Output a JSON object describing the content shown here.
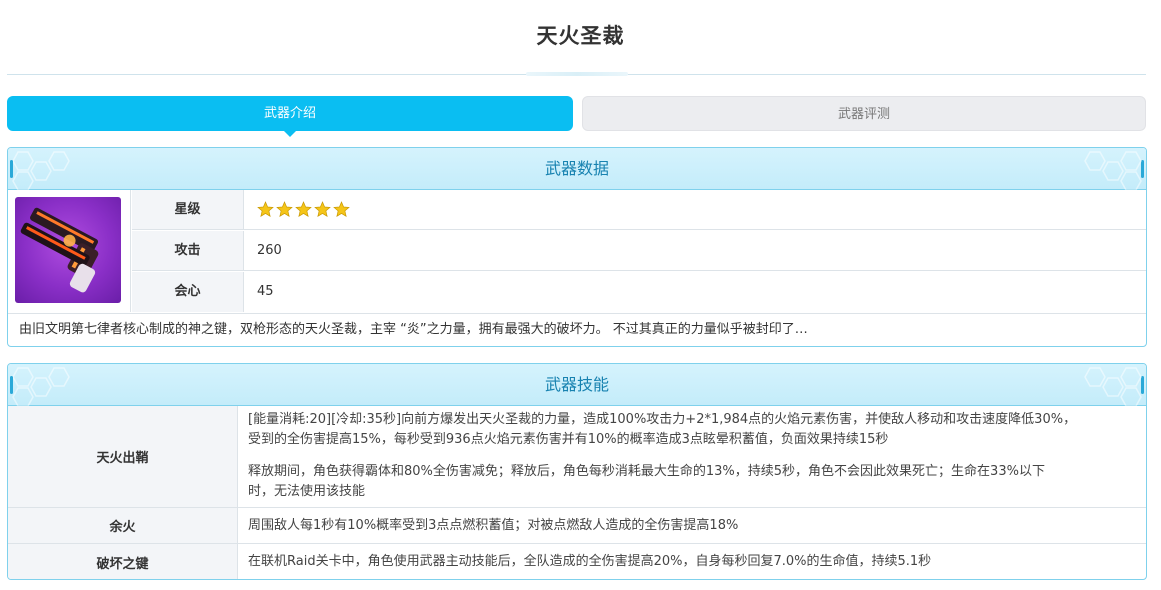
{
  "page": {
    "title": "天火圣裁"
  },
  "tabs": [
    {
      "label": "武器介绍",
      "active": true
    },
    {
      "label": "武器评测",
      "active": false
    }
  ],
  "weapon_data": {
    "header": "武器数据",
    "rarity": {
      "label": "星级",
      "stars": 5
    },
    "attack": {
      "label": "攻击",
      "value": "260"
    },
    "crit": {
      "label": "会心",
      "value": "45"
    },
    "description": "由旧文明第七律者核心制成的神之键，双枪形态的天火圣裁，主宰 “炎”之力量，拥有最强大的破坏力。 不过其真正的力量似乎被封印了…"
  },
  "weapon_skills": {
    "header": "武器技能",
    "skills": [
      {
        "name": "天火出鞘",
        "desc_lines": [
          "[能量消耗:20][冷却:35秒]向前方爆发出天火圣裁的力量，造成100%攻击力+2*1,984点的火焰元素伤害，并使敌人移动和攻击速度降低30%，",
          "受到的全伤害提高15%，每秒受到936点火焰元素伤害并有10%的概率造成3点眩晕积蓄值，负面效果持续15秒",
          "释放期间，角色获得霸体和80%全伤害减免；释放后，角色每秒消耗最大生命的13%，持续5秒，角色不会因此效果死亡；生命在33%以下",
          "时，无法使用该技能"
        ]
      },
      {
        "name": "余火",
        "desc_lines": [
          "周围敌人每1秒有10%概率受到3点点燃积蓄值；对被点燃敌人造成的全伤害提高18%"
        ]
      },
      {
        "name": "破坏之键",
        "desc_lines": [
          "在联机Raid关卡中，角色使用武器主动技能后，全队造成的全伤害提高20%，自身每秒回复7.0%的生命值，持续5.1秒"
        ]
      }
    ]
  },
  "colors": {
    "accent": "#0abef2",
    "header_text": "#1782b0",
    "border": "#7fd1ec",
    "star": "#f5c518"
  },
  "icons": {
    "star": "star-icon",
    "weapon": "weapon-image"
  }
}
